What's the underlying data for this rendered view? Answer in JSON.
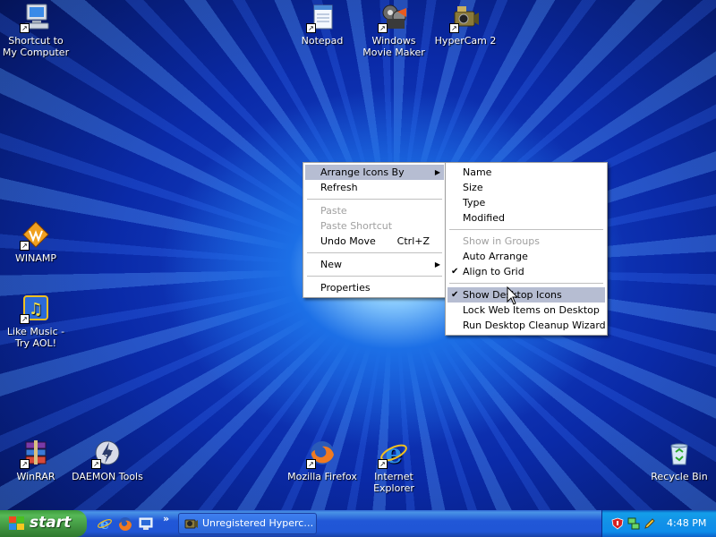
{
  "desktop": {
    "icons": [
      {
        "label": "Shortcut to My Computer",
        "icon": "my-computer-icon"
      },
      {
        "label": "Notepad",
        "icon": "notepad-icon"
      },
      {
        "label": "Windows Movie Maker",
        "icon": "movie-maker-icon"
      },
      {
        "label": "HyperCam 2",
        "icon": "hypercam-icon"
      },
      {
        "label": "WINAMP",
        "icon": "winamp-icon"
      },
      {
        "label": "Like Music - Try AOL!",
        "icon": "aol-music-icon"
      },
      {
        "label": "WinRAR",
        "icon": "winrar-icon"
      },
      {
        "label": "DAEMON Tools",
        "icon": "daemon-tools-icon"
      },
      {
        "label": "Mozilla Firefox",
        "icon": "firefox-icon"
      },
      {
        "label": "Internet Explorer",
        "icon": "internet-explorer-icon"
      },
      {
        "label": "Recycle Bin",
        "icon": "recycle-bin-icon"
      }
    ]
  },
  "context_menu": {
    "items": [
      {
        "label": "Arrange Icons By",
        "state": "highlighted",
        "submenu": true
      },
      {
        "label": "Refresh"
      },
      {
        "label": "Paste",
        "state": "disabled"
      },
      {
        "label": "Paste Shortcut",
        "state": "disabled"
      },
      {
        "label": "Undo Move",
        "shortcut": "Ctrl+Z"
      },
      {
        "label": "New",
        "submenu": true
      },
      {
        "label": "Properties"
      }
    ]
  },
  "submenu": {
    "items": [
      {
        "label": "Name"
      },
      {
        "label": "Size"
      },
      {
        "label": "Type"
      },
      {
        "label": "Modified"
      },
      {
        "label": "Show in Groups",
        "state": "disabled"
      },
      {
        "label": "Auto Arrange"
      },
      {
        "label": "Align to Grid",
        "checked": true
      },
      {
        "label": "Show Desktop Icons",
        "checked": true,
        "state": "highlighted"
      },
      {
        "label": "Lock Web Items on Desktop"
      },
      {
        "label": "Run Desktop Cleanup Wizard"
      }
    ]
  },
  "taskbar": {
    "start_label": "start",
    "quick_launch": [
      "internet-explorer-icon",
      "firefox-icon",
      "desktop-icon"
    ],
    "chevron": "»",
    "tasks": [
      {
        "label": "Unregistered Hyperc…",
        "icon": "hypercam-icon"
      }
    ],
    "tray_icons": [
      "security-shield-icon",
      "network-icon",
      "pencil-icon"
    ],
    "clock": "4:48 PM"
  },
  "colors": {
    "menu_highlight": "#b6bdd2",
    "taskbar_blue": "#2157d7",
    "start_green": "#3d8f3d",
    "tray_blue": "#1290e8"
  }
}
